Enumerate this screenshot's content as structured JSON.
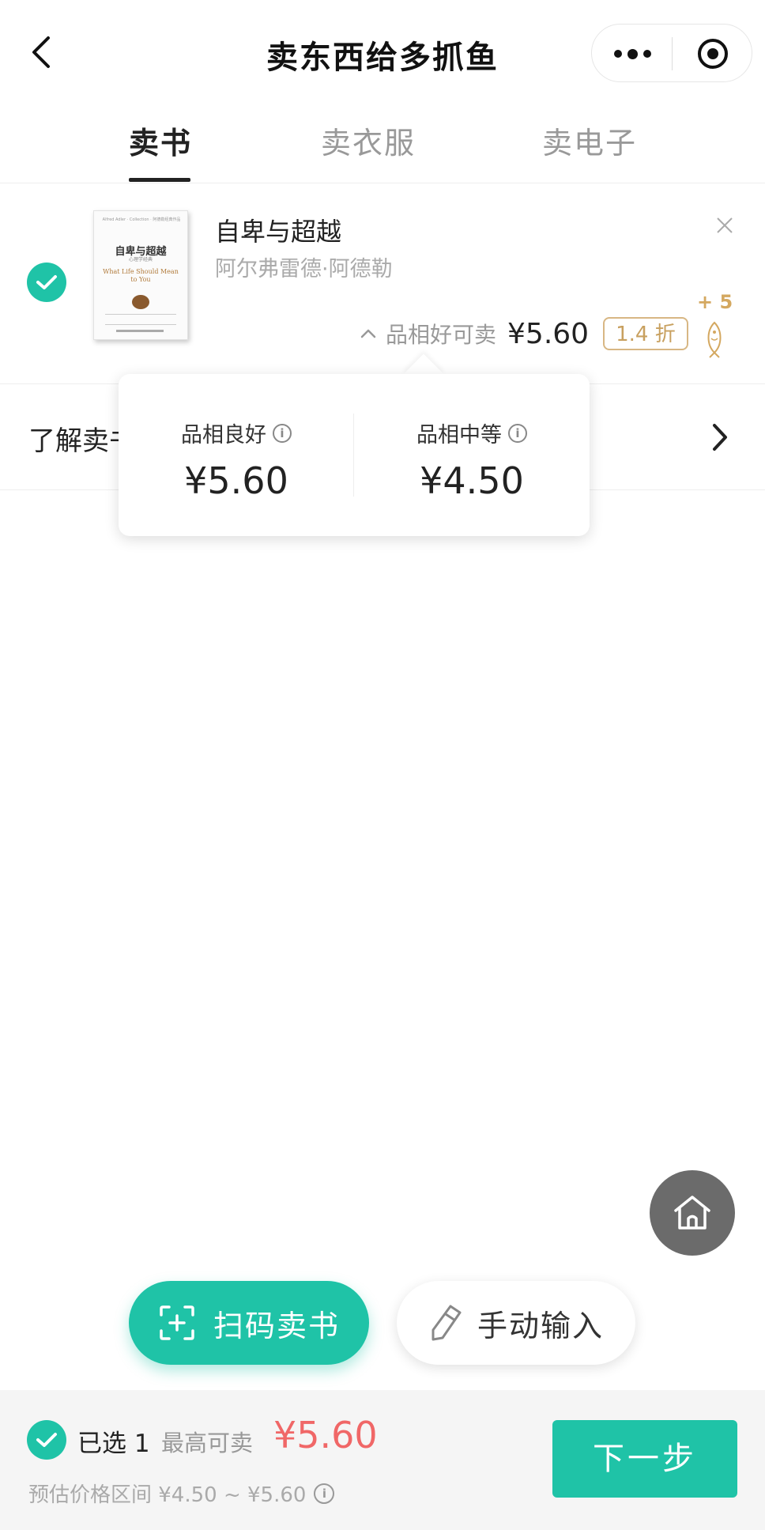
{
  "header": {
    "title": "卖东西给多抓鱼",
    "back_icon": "chevron-left-icon",
    "more_icon": "more-dots-icon",
    "close_miniprogram_icon": "target-circle-icon"
  },
  "tabs": [
    {
      "label": "卖书",
      "active": true
    },
    {
      "label": "卖衣服",
      "active": false
    },
    {
      "label": "卖电子",
      "active": false
    }
  ],
  "book": {
    "title": "自卑与超越",
    "author": "阿尔弗雷德·阿德勒",
    "condition_label": "品相好可卖",
    "price": "¥5.60",
    "discount": "1.4 折",
    "coin_bonus": "+ 5",
    "cover": {
      "title": "自卑与超越",
      "english": "What Life Should Mean to You"
    }
  },
  "info_row": {
    "text": "了解卖书"
  },
  "popup": {
    "good": {
      "label": "品相良好",
      "price": "¥5.60"
    },
    "medium": {
      "label": "品相中等",
      "price": "¥4.50"
    }
  },
  "actions": {
    "scan_label": "扫码卖书",
    "manual_label": "手动输入"
  },
  "bottom_bar": {
    "selected_text": "已选 1",
    "max_label": "最高可卖",
    "max_price": "¥5.60",
    "range_text": "预估价格区间 ¥4.50 ~ ¥5.60",
    "next_label": "下一步"
  },
  "colors": {
    "accent": "#1fc3a7",
    "price_red": "#f06767",
    "gold": "#c8a05f"
  }
}
